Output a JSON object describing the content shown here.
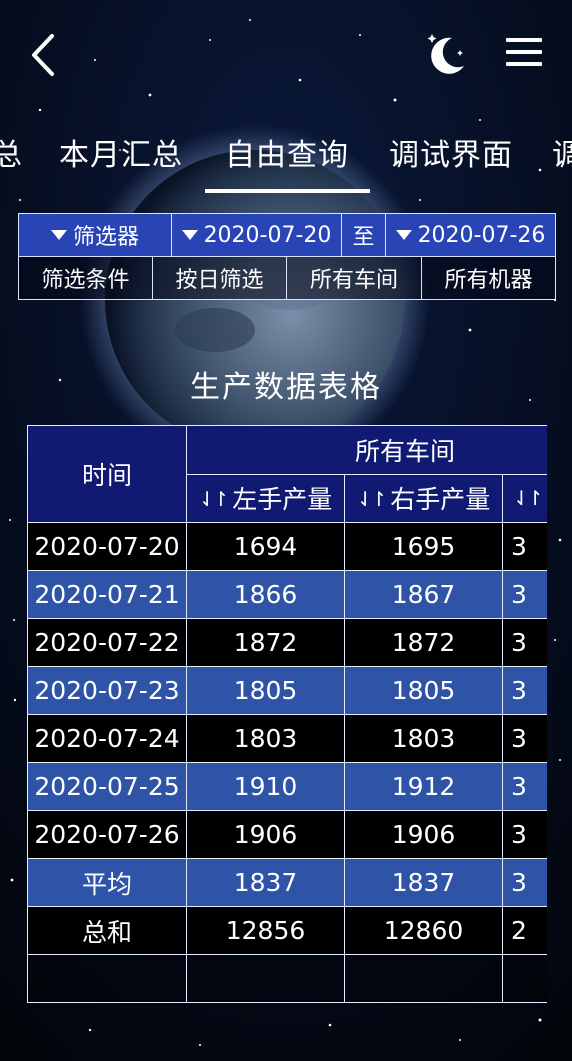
{
  "theme": {
    "accent": "#2944b4",
    "header_bg": "#101a72",
    "row_dark": "#000000",
    "row_blue": "#2f53a6"
  },
  "header": {
    "back_icon": "chevron-left-icon",
    "night_icon": "moon-stars-icon",
    "menu_icon": "hamburger-menu-icon"
  },
  "tabs": [
    {
      "label": "总",
      "active": false
    },
    {
      "label": "本月汇总",
      "active": false
    },
    {
      "label": "自由查询",
      "active": true
    },
    {
      "label": "调试界面",
      "active": false
    },
    {
      "label": "调",
      "active": false
    }
  ],
  "filter": {
    "filter_label": "筛选器",
    "start_date": "2020-07-20",
    "to_label": "至",
    "end_date": "2020-07-26",
    "condition_label": "筛选条件",
    "mode_label": "按日筛选",
    "workshop_label": "所有车间",
    "machine_label": "所有机器"
  },
  "table": {
    "title": "生产数据表格",
    "time_header": "时间",
    "group_header": "所有车间",
    "columns": [
      "左手产量",
      "右手产量",
      ""
    ],
    "rows": [
      {
        "time": "2020-07-20",
        "left": "1694",
        "right": "1695",
        "third": "3"
      },
      {
        "time": "2020-07-21",
        "left": "1866",
        "right": "1867",
        "third": "3"
      },
      {
        "time": "2020-07-22",
        "left": "1872",
        "right": "1872",
        "third": "3"
      },
      {
        "time": "2020-07-23",
        "left": "1805",
        "right": "1805",
        "third": "3"
      },
      {
        "time": "2020-07-24",
        "left": "1803",
        "right": "1803",
        "third": "3"
      },
      {
        "time": "2020-07-25",
        "left": "1910",
        "right": "1912",
        "third": "3"
      },
      {
        "time": "2020-07-26",
        "left": "1906",
        "right": "1906",
        "third": "3"
      },
      {
        "time": "平均",
        "left": "1837",
        "right": "1837",
        "third": "3"
      },
      {
        "time": "总和",
        "left": "12856",
        "right": "12860",
        "third": "2"
      }
    ]
  }
}
